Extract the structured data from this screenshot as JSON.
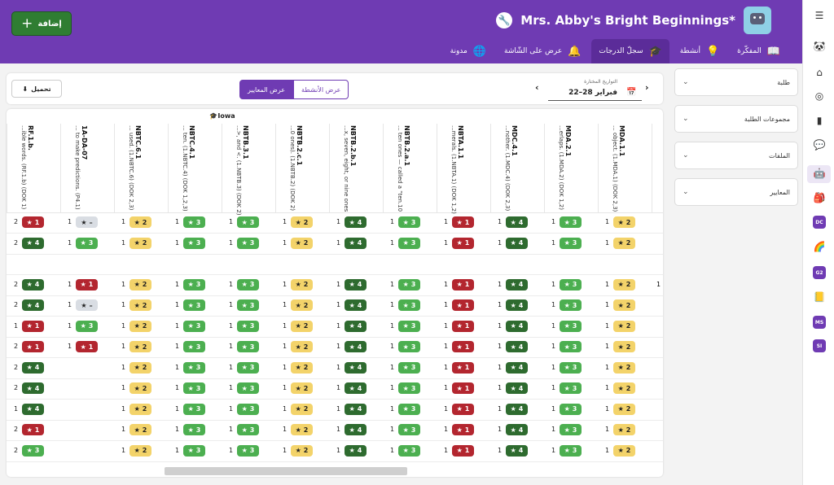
{
  "header": {
    "class_title": "Mrs. Abby's Bright Beginnings*",
    "add_button": "إضافة",
    "tabs": [
      {
        "label": "المفكّرة",
        "icon": "notebook-icon"
      },
      {
        "label": "أنشطة",
        "icon": "lightbulb-icon"
      },
      {
        "label": "سجلّ الدرجات",
        "icon": "graduation-cap-icon",
        "active": true
      },
      {
        "label": "عرض على الشّاشة",
        "icon": "bell-icon"
      },
      {
        "label": "مدونة",
        "icon": "globe-icon"
      }
    ]
  },
  "toolbar": {
    "download": "تحميل",
    "view_standards": "عرض المعايير",
    "view_activities": "عرض الأنشطة",
    "date_label": "التواريخ المختارة",
    "date_value": "22–28 فبراير"
  },
  "filters": [
    "طلبة",
    "مجموعات الطلبة",
    "الملفات",
    "المعايير"
  ],
  "grid": {
    "state": "Iowa",
    "columns": [
      {
        "code": "RF.1.b.",
        "desc": "...ible words. (RF.1.b) (DOK 1)"
      },
      {
        "code": "1A-DA-07",
        "desc": "... to make predictions. (P4.1)"
      },
      {
        "code": "NBTC.6.1",
        "desc": "... used. (1.NBTC.6) (DOK 2,3)"
      },
      {
        "code": "NBTC.4.1",
        "desc": "... ten. (1.NBTC.4) (DOK 1,2,3)"
      },
      {
        "code": "NBTB.3.1",
        "desc": "...>, and <. (1.NBTB.3) (DOK 2)"
      },
      {
        "code": "NBTB.2.c.1",
        "desc": "...0 ones). (1.NBTB.2) (DOK 2)"
      },
      {
        "code": "NBTB.2.b.1",
        "desc": "...x, seven, eight, or nine ones"
      },
      {
        "code": "NBTB.2.a.1",
        "desc": "... ten ones — called a \"ten.10"
      },
      {
        "code": "NBTA.1.1",
        "desc": "...merals. (1.NBTA.1) (DOK 1,2)"
      },
      {
        "code": "MDC.4.1",
        "desc": "...nother. (1.MDC.4) (DOK 2,3)"
      },
      {
        "code": "MDA.2.1",
        "desc": "...erlaps. (1.MDA.2) (DOK 1,2)"
      },
      {
        "code": "MDA.1.1",
        "desc": "... object. (1.MDA.1) (DOK 2,3)"
      }
    ],
    "rows": [
      [
        [
          2,
          1
        ],
        [
          1,
          0
        ],
        [
          1,
          2
        ],
        [
          1,
          3
        ],
        [
          1,
          3
        ],
        [
          1,
          2
        ],
        [
          1,
          4
        ],
        [
          1,
          3
        ],
        [
          1,
          1
        ],
        [
          1,
          4
        ],
        [
          1,
          3
        ],
        [
          1,
          2
        ]
      ],
      [
        [
          2,
          4
        ],
        [
          1,
          3
        ],
        [
          1,
          2
        ],
        [
          1,
          3
        ],
        [
          1,
          3
        ],
        [
          1,
          2
        ],
        [
          1,
          4
        ],
        [
          1,
          3
        ],
        [
          1,
          1
        ],
        [
          1,
          4
        ],
        [
          1,
          3
        ],
        [
          1,
          2
        ]
      ],
      [],
      [
        [
          2,
          4
        ],
        [
          1,
          1
        ],
        [
          1,
          2
        ],
        [
          1,
          3
        ],
        [
          1,
          3
        ],
        [
          1,
          2
        ],
        [
          1,
          4
        ],
        [
          1,
          3
        ],
        [
          1,
          1
        ],
        [
          1,
          4
        ],
        [
          1,
          3
        ],
        [
          1,
          2
        ]
      ],
      [
        [
          2,
          4
        ],
        [
          1,
          0
        ],
        [
          1,
          2
        ],
        [
          1,
          3
        ],
        [
          1,
          3
        ],
        [
          1,
          2
        ],
        [
          1,
          4
        ],
        [
          1,
          3
        ],
        [
          1,
          1
        ],
        [
          1,
          4
        ],
        [
          1,
          3
        ],
        [
          1,
          2
        ]
      ],
      [
        [
          1,
          1
        ],
        [
          1,
          3
        ],
        [
          1,
          2
        ],
        [
          1,
          3
        ],
        [
          1,
          3
        ],
        [
          1,
          2
        ],
        [
          1,
          4
        ],
        [
          1,
          3
        ],
        [
          1,
          1
        ],
        [
          1,
          4
        ],
        [
          1,
          3
        ],
        [
          1,
          2
        ]
      ],
      [
        [
          2,
          1
        ],
        [
          1,
          1
        ],
        [
          1,
          2
        ],
        [
          1,
          3
        ],
        [
          1,
          3
        ],
        [
          1,
          2
        ],
        [
          1,
          4
        ],
        [
          1,
          3
        ],
        [
          1,
          1
        ],
        [
          1,
          4
        ],
        [
          1,
          3
        ],
        [
          1,
          2
        ]
      ],
      [
        [
          2,
          4
        ],
        null,
        [
          1,
          2
        ],
        [
          1,
          3
        ],
        [
          1,
          3
        ],
        [
          1,
          2
        ],
        [
          1,
          4
        ],
        [
          1,
          3
        ],
        [
          1,
          1
        ],
        [
          1,
          4
        ],
        [
          1,
          3
        ],
        [
          1,
          2
        ]
      ],
      [
        [
          2,
          4
        ],
        null,
        [
          1,
          2
        ],
        [
          1,
          3
        ],
        [
          1,
          3
        ],
        [
          1,
          2
        ],
        [
          1,
          4
        ],
        [
          1,
          3
        ],
        [
          1,
          1
        ],
        [
          1,
          4
        ],
        [
          1,
          3
        ],
        [
          1,
          2
        ]
      ],
      [
        [
          1,
          4
        ],
        null,
        [
          1,
          2
        ],
        [
          1,
          3
        ],
        [
          1,
          3
        ],
        [
          1,
          2
        ],
        [
          1,
          4
        ],
        [
          1,
          3
        ],
        [
          1,
          1
        ],
        [
          1,
          4
        ],
        [
          1,
          3
        ],
        [
          1,
          2
        ]
      ],
      [
        [
          2,
          1
        ],
        null,
        [
          1,
          2
        ],
        [
          1,
          3
        ],
        [
          1,
          3
        ],
        [
          1,
          2
        ],
        [
          1,
          4
        ],
        [
          1,
          3
        ],
        [
          1,
          1
        ],
        [
          1,
          4
        ],
        [
          1,
          3
        ],
        [
          1,
          2
        ]
      ],
      [
        [
          2,
          3
        ],
        null,
        [
          1,
          2
        ],
        [
          1,
          3
        ],
        [
          1,
          3
        ],
        [
          1,
          2
        ],
        [
          1,
          4
        ],
        [
          1,
          3
        ],
        [
          1,
          1
        ],
        [
          1,
          4
        ],
        [
          1,
          3
        ],
        [
          1,
          2
        ]
      ]
    ],
    "level_colors": {
      "0": "#d9dde3",
      "1": "#b3262f",
      "2": "#f3d36a",
      "3": "#4caf50",
      "4": "#2e6b2f"
    },
    "partial_cell_value": "1"
  },
  "rail": {
    "badges": [
      {
        "text": "DC",
        "color": "#6f3bb3"
      },
      {
        "text": "G2",
        "color": "#6f3bb3"
      },
      {
        "text": "MS",
        "color": "#6f3bb3"
      },
      {
        "text": "SI",
        "color": "#6f3bb3"
      }
    ]
  }
}
